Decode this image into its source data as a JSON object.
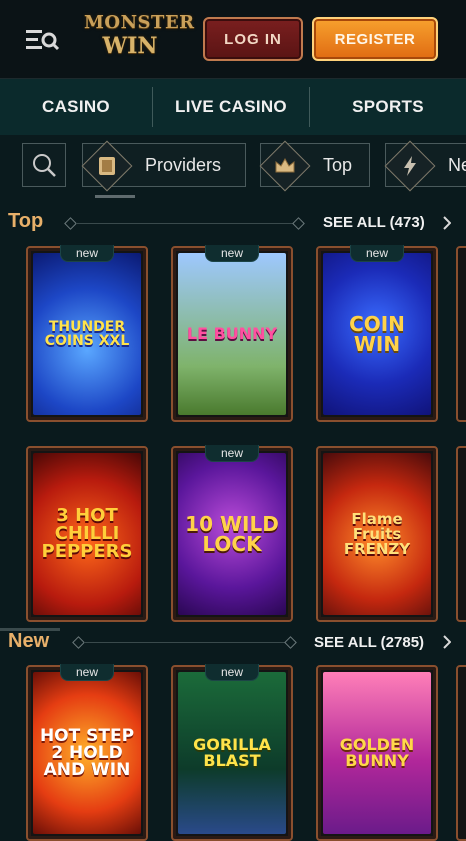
{
  "header": {
    "logo_line1": "MONSTER",
    "logo_line2": "WIN",
    "login_label": "LOG IN",
    "register_label": "REGISTER"
  },
  "nav": {
    "items": [
      {
        "label": "CASINO"
      },
      {
        "label": "LIVE CASINO"
      },
      {
        "label": "SPORTS"
      }
    ]
  },
  "filters": {
    "chips": [
      {
        "label": "Providers",
        "icon": "book-icon"
      },
      {
        "label": "Top",
        "icon": "crown-icon"
      },
      {
        "label": "Ne",
        "icon": "lightning-icon"
      }
    ]
  },
  "sections": {
    "top": {
      "title": "Top",
      "see_all": "SEE ALL (473)",
      "games": [
        {
          "title": "THUNDER COINS XXL",
          "badge": "new"
        },
        {
          "title": "LE BUNNY",
          "badge": "new"
        },
        {
          "title": "COIN WIN",
          "badge": "new"
        },
        {
          "title": "3 HOT CHILLI PEPPERS",
          "badge": ""
        },
        {
          "title": "10 WILD LOCK",
          "badge": "new"
        },
        {
          "title": "Flame Fruits FRENZY",
          "badge": ""
        }
      ]
    },
    "new": {
      "title": "New",
      "see_all": "SEE ALL (2785)",
      "games": [
        {
          "title": "HOT STEP 2 HOLD AND WIN",
          "badge": "new"
        },
        {
          "title": "GORILLA BLAST",
          "badge": "new"
        },
        {
          "title": "GOLDEN BUNNY",
          "badge": ""
        }
      ]
    }
  },
  "colors": {
    "accent": "#e8b06a",
    "register": "#f08a1f",
    "login": "#6b1a1a",
    "nav_bg": "#0b2a2c"
  }
}
